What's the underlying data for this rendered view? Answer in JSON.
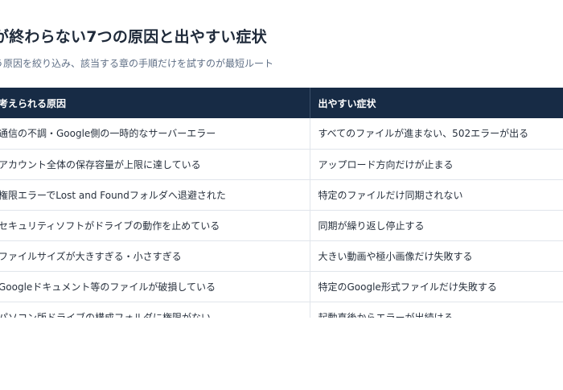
{
  "title": "が終わらない7つの原因と出やすい症状",
  "subtitle": "う原因を絞り込み、該当する章の手順だけを試すのが最短ルート",
  "table": {
    "headers": [
      "考えられる原因",
      "出やすい症状"
    ],
    "rows": [
      [
        "通信の不調・Google側の一時的なサーバーエラー",
        "すべてのファイルが進まない、502エラーが出る"
      ],
      [
        "アカウント全体の保存容量が上限に達している",
        "アップロード方向だけが止まる"
      ],
      [
        "権限エラーでLost and Foundフォルダへ退避された",
        "特定のファイルだけ同期されない"
      ],
      [
        "セキュリティソフトがドライブの動作を止めている",
        "同期が繰り返し停止する"
      ],
      [
        "ファイルサイズが大きすぎる・小さすぎる",
        "大きい動画や極小画像だけ失敗する"
      ],
      [
        "Googleドキュメント等のファイルが破損している",
        "特定のGoogle形式ファイルだけ失敗する"
      ],
      [
        "パソコン版ドライブの構成フォルダに権限がない",
        "起動直後からエラーが出続ける"
      ]
    ]
  }
}
